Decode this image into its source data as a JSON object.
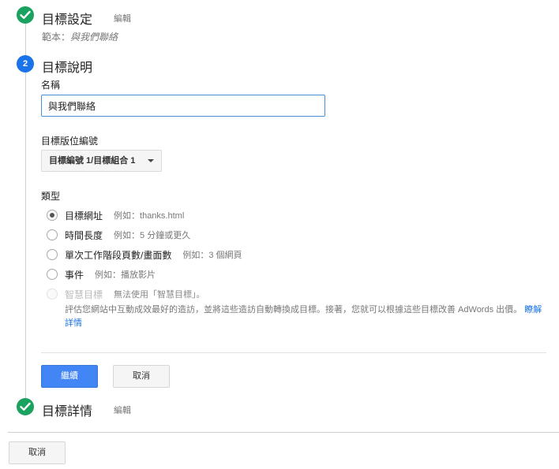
{
  "step1": {
    "title": "目標設定",
    "edit_label": "編輯",
    "summary_prefix": "範本：",
    "summary_value": "與我們聯絡"
  },
  "step2": {
    "number": "2",
    "title": "目標說明",
    "name_label": "名稱",
    "name_value": "與我們聯絡",
    "slot_label": "目標版位編號",
    "slot_selected": "目標編號 1/目標組合 1",
    "type_label": "類型",
    "types": [
      {
        "label": "目標網址",
        "hint": "例如：thanks.html",
        "checked": true,
        "disabled": false
      },
      {
        "label": "時間長度",
        "hint": "例如：5 分鐘或更久",
        "checked": false,
        "disabled": false
      },
      {
        "label": "單次工作階段頁數/畫面數",
        "hint": "例如：3 個網頁",
        "checked": false,
        "disabled": false
      },
      {
        "label": "事件",
        "hint": "例如：播放影片",
        "checked": false,
        "disabled": false
      },
      {
        "label": "智慧目標",
        "hint": "無法使用「智慧目標」。",
        "checked": false,
        "disabled": true
      }
    ],
    "smart_description": "評估您網站中互動成效最好的造訪，並將這些造訪自動轉換成目標。接著，您就可以根據這些目標改善 AdWords 出價。",
    "learn_more": "瞭解詳情",
    "continue_label": "繼續",
    "cancel_label": "取消"
  },
  "step3": {
    "title": "目標詳情",
    "edit_label": "編輯"
  },
  "footer": {
    "cancel_label": "取消"
  },
  "colors": {
    "check_green": "#1aa260",
    "step_blue": "#1a73e8",
    "primary_button": "#4285f4",
    "link": "#1a73e8"
  }
}
